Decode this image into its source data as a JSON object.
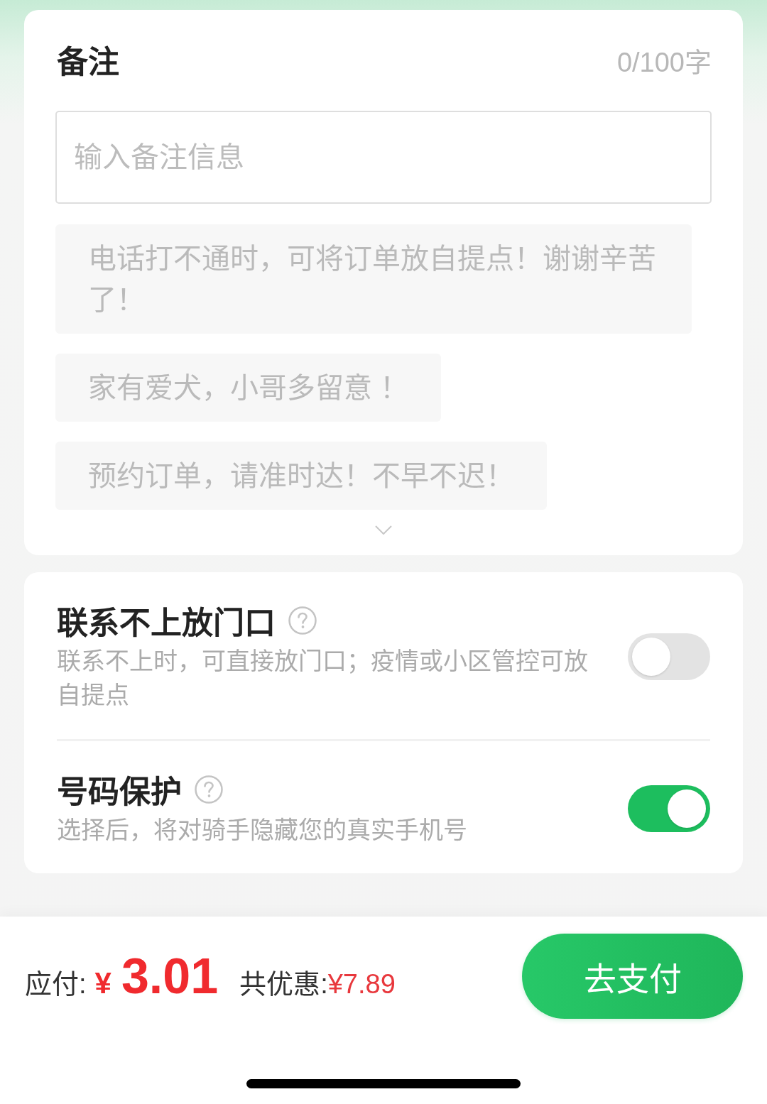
{
  "remark": {
    "title": "备注",
    "counter": "0/100字",
    "input": {
      "placeholder": "输入备注信息"
    },
    "suggestions": [
      "电话打不通时，可将订单放自提点！谢谢辛苦了！",
      "家有爱犬，小哥多留意 ！",
      "预约订单，请准时达！不早不迟！"
    ]
  },
  "options": [
    {
      "title": "联系不上放门口",
      "description": "联系不上时，可直接放门口；疫情或小区管控可放自提点",
      "on": false
    },
    {
      "title": "号码保护",
      "description": "选择后，将对骑手隐藏您的真实手机号",
      "on": true
    }
  ],
  "footer": {
    "payable_label": "应付:",
    "currency": "¥",
    "amount": "3.01",
    "discount_label": "共优惠:",
    "discount": "¥7.89",
    "pay_button": "去支付"
  }
}
